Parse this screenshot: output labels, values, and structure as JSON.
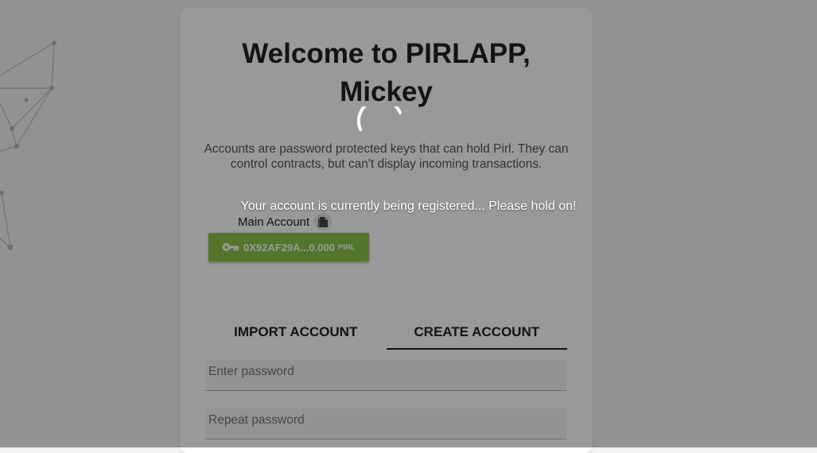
{
  "welcome": {
    "title_line1": "Welcome to PIRLAPP,",
    "title_line2": "Mickey"
  },
  "description": "Accounts are password protected keys that can hold Pirl. They can control contracts, but can't display incoming transactions.",
  "account": {
    "label": "Main Account",
    "address": "0X92AF29A...",
    "balance": "0.000",
    "unit": "PIRL",
    "button_color": "#8bc34a"
  },
  "tabs": [
    {
      "label": "IMPORT ACCOUNT",
      "active": false
    },
    {
      "label": "CREATE ACCOUNT",
      "active": true
    }
  ],
  "form": {
    "password_placeholder": "Enter password",
    "repeat_placeholder": "Repeat password"
  },
  "overlay": {
    "message": "Your account is currently being registered... Please hold on!"
  },
  "icons": {
    "copy": "copy-icon",
    "key": "key-icon",
    "spinner": "loading-spinner"
  }
}
